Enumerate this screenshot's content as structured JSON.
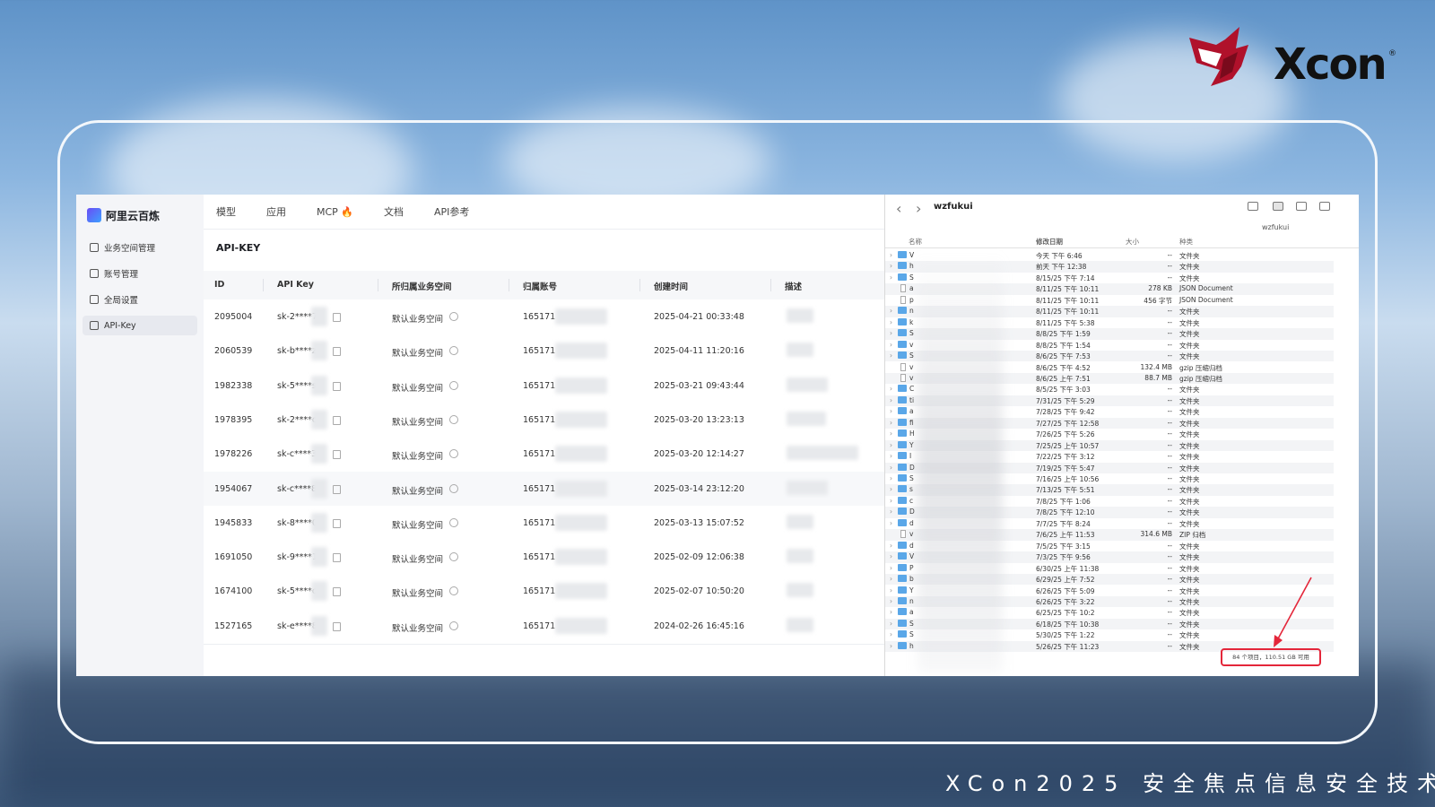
{
  "brand": {
    "logo_text": "Xcon",
    "footer_text": "XCon2025 安全焦点信息安全技术"
  },
  "console": {
    "product_name": "阿里云百炼",
    "nav": [
      "模型",
      "应用",
      "MCP 🔥",
      "文档",
      "API参考"
    ],
    "sidebar": [
      {
        "label": "业务空间管理",
        "icon": "home-icon"
      },
      {
        "label": "账号管理",
        "icon": "user-icon"
      },
      {
        "label": "全局设置",
        "icon": "settings-icon"
      },
      {
        "label": "API-Key",
        "icon": "key-icon",
        "active": true
      }
    ],
    "page_title": "API-KEY",
    "columns": [
      "ID",
      "API Key",
      "所归属业务空间",
      "归属账号",
      "创建时间",
      "描述"
    ],
    "rows": [
      {
        "id": "2095004",
        "key": "sk-2****7",
        "space": "默认业务空间",
        "account": "165171",
        "created": "2025-04-21 00:33:48"
      },
      {
        "id": "2060539",
        "key": "sk-b****z",
        "space": "默认业务空间",
        "account": "165171",
        "created": "2025-04-11 11:20:16"
      },
      {
        "id": "1982338",
        "key": "sk-5****s",
        "space": "默认业务空间",
        "account": "165171",
        "created": "2025-03-21 09:43:44"
      },
      {
        "id": "1978395",
        "key": "sk-2****c",
        "space": "默认业务空间",
        "account": "165171",
        "created": "2025-03-20 13:23:13"
      },
      {
        "id": "1978226",
        "key": "sk-c****3",
        "space": "默认业务空间",
        "account": "165171",
        "created": "2025-03-20 12:14:27"
      },
      {
        "id": "1954067",
        "key": "sk-c****8",
        "space": "默认业务空间",
        "account": "165171",
        "created": "2025-03-14 23:12:20"
      },
      {
        "id": "1945833",
        "key": "sk-8****0",
        "space": "默认业务空间",
        "account": "165171",
        "created": "2025-03-13 15:07:52"
      },
      {
        "id": "1691050",
        "key": "sk-9****1",
        "space": "默认业务空间",
        "account": "165171",
        "created": "2025-02-09 12:06:38"
      },
      {
        "id": "1674100",
        "key": "sk-5****c",
        "space": "默认业务空间",
        "account": "165171",
        "created": "2025-02-07 10:50:20"
      },
      {
        "id": "1527165",
        "key": "sk-e****8",
        "space": "默认业务空间",
        "account": "165171",
        "created": "2024-02-26 16:45:16"
      }
    ]
  },
  "finder": {
    "title": "wzfukui",
    "subtitle": "wzfukui",
    "columns": [
      "名称",
      "修改日期",
      "大小",
      "种类"
    ],
    "items": [
      {
        "n": "V",
        "date": "今天 下午 6:46",
        "size": "--",
        "kind": "文件夹",
        "t": "folder"
      },
      {
        "n": "h",
        "date": "前天 下午 12:38",
        "size": "--",
        "kind": "文件夹",
        "t": "folder"
      },
      {
        "n": "S",
        "date": "8/15/25 下午 7:14",
        "size": "--",
        "kind": "文件夹",
        "t": "folder"
      },
      {
        "n": "a",
        "date": "8/11/25 下午 10:11",
        "size": "278 KB",
        "kind": "JSON Document",
        "t": "file"
      },
      {
        "n": "p",
        "date": "8/11/25 下午 10:11",
        "size": "456 字节",
        "kind": "JSON Document",
        "t": "file"
      },
      {
        "n": "n",
        "date": "8/11/25 下午 10:11",
        "size": "--",
        "kind": "文件夹",
        "t": "folder"
      },
      {
        "n": "k",
        "date": "8/11/25 下午 5:38",
        "size": "--",
        "kind": "文件夹",
        "t": "folder"
      },
      {
        "n": "S",
        "date": "8/8/25 下午 1:59",
        "size": "--",
        "kind": "文件夹",
        "t": "folder"
      },
      {
        "n": "v",
        "date": "8/8/25 下午 1:54",
        "size": "--",
        "kind": "文件夹",
        "t": "folder"
      },
      {
        "n": "S",
        "date": "8/6/25 下午 7:53",
        "size": "--",
        "kind": "文件夹",
        "t": "folder"
      },
      {
        "n": "v",
        "date": "8/6/25 下午 4:52",
        "size": "132.4 MB",
        "kind": "gzip 压缩归档",
        "t": "file"
      },
      {
        "n": "v",
        "date": "8/6/25 上午 7:51",
        "size": "88.7 MB",
        "kind": "gzip 压缩归档",
        "t": "file"
      },
      {
        "n": "C",
        "date": "8/5/25 下午 3:03",
        "size": "--",
        "kind": "文件夹",
        "t": "folder"
      },
      {
        "n": "ti",
        "date": "7/31/25 下午 5:29",
        "size": "--",
        "kind": "文件夹",
        "t": "folder"
      },
      {
        "n": "a",
        "date": "7/28/25 下午 9:42",
        "size": "--",
        "kind": "文件夹",
        "t": "folder"
      },
      {
        "n": "fi",
        "date": "7/27/25 下午 12:58",
        "size": "--",
        "kind": "文件夹",
        "t": "folder"
      },
      {
        "n": "H",
        "date": "7/26/25 下午 5:26",
        "size": "--",
        "kind": "文件夹",
        "t": "folder"
      },
      {
        "n": "Y",
        "date": "7/25/25 上午 10:57",
        "size": "--",
        "kind": "文件夹",
        "t": "folder"
      },
      {
        "n": "I",
        "date": "7/22/25 下午 3:12",
        "size": "--",
        "kind": "文件夹",
        "t": "folder"
      },
      {
        "n": "D",
        "date": "7/19/25 下午 5:47",
        "size": "--",
        "kind": "文件夹",
        "t": "folder"
      },
      {
        "n": "S",
        "date": "7/16/25 上午 10:56",
        "size": "--",
        "kind": "文件夹",
        "t": "folder"
      },
      {
        "n": "s",
        "date": "7/13/25 下午 5:51",
        "size": "--",
        "kind": "文件夹",
        "t": "folder"
      },
      {
        "n": "c",
        "date": "7/8/25 下午 1:06",
        "size": "--",
        "kind": "文件夹",
        "t": "folder"
      },
      {
        "n": "D",
        "date": "7/8/25 下午 12:10",
        "size": "--",
        "kind": "文件夹",
        "t": "folder"
      },
      {
        "n": "d",
        "date": "7/7/25 下午 8:24",
        "size": "--",
        "kind": "文件夹",
        "t": "folder"
      },
      {
        "n": "v",
        "date": "7/6/25 上午 11:53",
        "size": "314.6 MB",
        "kind": "ZIP 归档",
        "t": "file"
      },
      {
        "n": "d",
        "date": "7/5/25 下午 3:15",
        "size": "--",
        "kind": "文件夹",
        "t": "folder"
      },
      {
        "n": "V",
        "date": "7/3/25 下午 9:56",
        "size": "--",
        "kind": "文件夹",
        "t": "folder"
      },
      {
        "n": "P",
        "date": "6/30/25 上午 11:38",
        "size": "--",
        "kind": "文件夹",
        "t": "folder"
      },
      {
        "n": "b",
        "date": "6/29/25 上午 7:52",
        "size": "--",
        "kind": "文件夹",
        "t": "folder"
      },
      {
        "n": "Y",
        "date": "6/26/25 下午 5:09",
        "size": "--",
        "kind": "文件夹",
        "t": "folder"
      },
      {
        "n": "n",
        "date": "6/26/25 下午 3:22",
        "size": "--",
        "kind": "文件夹",
        "t": "folder"
      },
      {
        "n": "a",
        "date": "6/25/25 下午 10:2",
        "size": "--",
        "kind": "文件夹",
        "t": "folder"
      },
      {
        "n": "S",
        "date": "6/18/25 下午 10:38",
        "size": "--",
        "kind": "文件夹",
        "t": "folder"
      },
      {
        "n": "S",
        "date": "5/30/25 下午 1:22",
        "size": "--",
        "kind": "文件夹",
        "t": "folder"
      },
      {
        "n": "h",
        "date": "5/26/25 下午 11:23",
        "size": "--",
        "kind": "文件夹",
        "t": "folder"
      }
    ],
    "status": "84 个项目，110.51 GB 可用"
  }
}
